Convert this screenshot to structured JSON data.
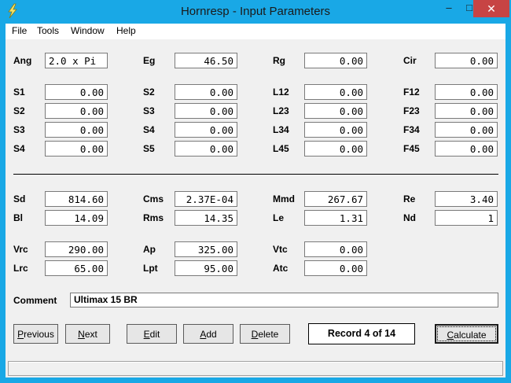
{
  "window": {
    "title": "Hornresp - Input Parameters",
    "min_symbol": "–",
    "max_symbol": "□",
    "close_symbol": "✕",
    "accent": "#19a8e6",
    "close_color": "#c74444"
  },
  "menu": [
    "File",
    "Tools",
    "Window",
    "Help"
  ],
  "params": {
    "ang": {
      "label": "Ang",
      "value": "2.0 x Pi"
    },
    "eg": {
      "label": "Eg",
      "value": "46.50"
    },
    "rg": {
      "label": "Rg",
      "value": "0.00"
    },
    "cir": {
      "label": "Cir",
      "value": "0.00"
    },
    "s1a": {
      "label": "S1",
      "value": "0.00"
    },
    "s2a": {
      "label": "S2",
      "value": "0.00"
    },
    "s3a": {
      "label": "S3",
      "value": "0.00"
    },
    "s4a": {
      "label": "S4",
      "value": "0.00"
    },
    "s2b": {
      "label": "S2",
      "value": "0.00"
    },
    "s3b": {
      "label": "S3",
      "value": "0.00"
    },
    "s4b": {
      "label": "S4",
      "value": "0.00"
    },
    "s5b": {
      "label": "S5",
      "value": "0.00"
    },
    "l12": {
      "label": "L12",
      "value": "0.00"
    },
    "l23": {
      "label": "L23",
      "value": "0.00"
    },
    "l34": {
      "label": "L34",
      "value": "0.00"
    },
    "l45": {
      "label": "L45",
      "value": "0.00"
    },
    "f12": {
      "label": "F12",
      "value": "0.00"
    },
    "f23": {
      "label": "F23",
      "value": "0.00"
    },
    "f34": {
      "label": "F34",
      "value": "0.00"
    },
    "f45": {
      "label": "F45",
      "value": "0.00"
    },
    "sd": {
      "label": "Sd",
      "value": "814.60"
    },
    "bl": {
      "label": "Bl",
      "value": "14.09"
    },
    "cms": {
      "label": "Cms",
      "value": "2.37E-04"
    },
    "rms": {
      "label": "Rms",
      "value": "14.35"
    },
    "mmd": {
      "label": "Mmd",
      "value": "267.67"
    },
    "le": {
      "label": "Le",
      "value": "1.31"
    },
    "re": {
      "label": "Re",
      "value": "3.40"
    },
    "nd": {
      "label": "Nd",
      "value": "1"
    },
    "vrc": {
      "label": "Vrc",
      "value": "290.00"
    },
    "lrc": {
      "label": "Lrc",
      "value": "65.00"
    },
    "ap": {
      "label": "Ap",
      "value": "325.00"
    },
    "lpt": {
      "label": "Lpt",
      "value": "95.00"
    },
    "vtc": {
      "label": "Vtc",
      "value": "0.00"
    },
    "atc": {
      "label": "Atc",
      "value": "0.00"
    }
  },
  "comment": {
    "label": "Comment",
    "value": "Ultimax 15 BR"
  },
  "buttons": {
    "previous": {
      "first": "P",
      "rest": "revious"
    },
    "next": {
      "first": "N",
      "rest": "ext"
    },
    "edit": {
      "first": "E",
      "rest": "dit"
    },
    "add": {
      "first": "A",
      "rest": "dd"
    },
    "delete": {
      "first": "D",
      "rest": "elete"
    },
    "calculate": {
      "first": "C",
      "rest": "alculate"
    }
  },
  "record": "Record 4 of 14",
  "icons": {
    "app": "lightning-bolt-icon"
  }
}
